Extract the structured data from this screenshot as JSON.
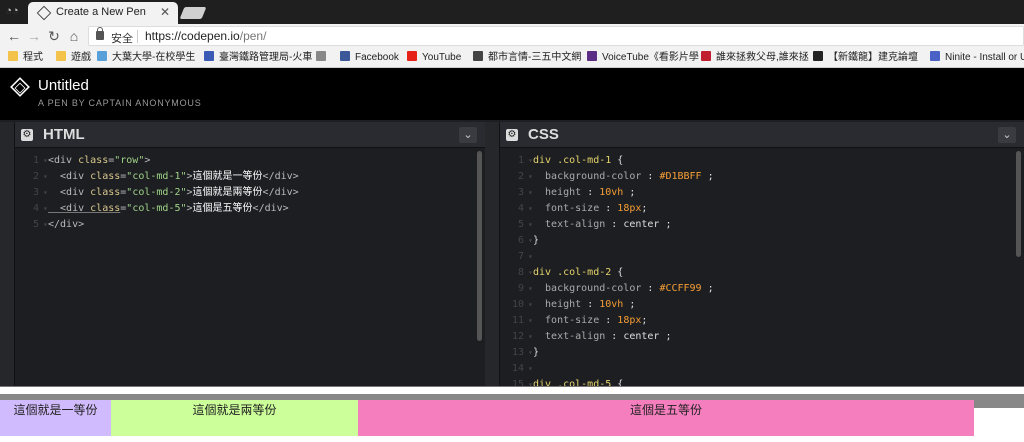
{
  "browser": {
    "tab_title": "Create a New Pen",
    "secure_label": "安全",
    "url_host": "https://codepen.io",
    "url_path": "/pen/",
    "bookmarks": [
      {
        "label": "程式",
        "color": "#f3c24b"
      },
      {
        "label": "遊戲",
        "color": "#f3c24b"
      },
      {
        "label": "大葉大學-在校學生",
        "color": "#5aa0d8"
      },
      {
        "label": "臺灣鐵路管理局-火車",
        "color": "#3b5bb5"
      },
      {
        "label": "",
        "color": "#888888"
      },
      {
        "label": "Facebook",
        "color": "#3b5998"
      },
      {
        "label": "YouTube",
        "color": "#e62117"
      },
      {
        "label": "都市言情-三五中文網",
        "color": "#444444"
      },
      {
        "label": "VoiceTube《看影片學",
        "color": "#5b2c83"
      },
      {
        "label": "誰來拯救父母,誰來拯",
        "color": "#c02030"
      },
      {
        "label": "【新鐵龍】建克論壇",
        "color": "#222222"
      },
      {
        "label": "Ninite - Install or Up",
        "color": "#4a62c6"
      }
    ]
  },
  "pen": {
    "title": "Untitled",
    "subtitle": "A PEN BY CAPTAIN ANONYMOUS"
  },
  "html_panel": {
    "label": "HTML",
    "lines": [
      {
        "n": "1",
        "tokens": [
          {
            "c": "t-tag",
            "t": "<div "
          },
          {
            "c": "t-attr",
            "t": "class"
          },
          {
            "c": "t-tag",
            "t": "="
          },
          {
            "c": "t-str",
            "t": "\"row\""
          },
          {
            "c": "t-tag",
            "t": ">"
          }
        ]
      },
      {
        "n": "2",
        "tokens": [
          {
            "c": "t-tag",
            "t": "  <div "
          },
          {
            "c": "t-attr",
            "t": "class"
          },
          {
            "c": "t-tag",
            "t": "="
          },
          {
            "c": "t-str",
            "t": "\"col-md-1\""
          },
          {
            "c": "t-tag",
            "t": ">"
          },
          {
            "c": "t-cjk",
            "t": "這個就是一等份"
          },
          {
            "c": "t-tag",
            "t": "</div>"
          }
        ]
      },
      {
        "n": "3",
        "tokens": [
          {
            "c": "t-tag",
            "t": "  <div "
          },
          {
            "c": "t-attr",
            "t": "class"
          },
          {
            "c": "t-tag",
            "t": "="
          },
          {
            "c": "t-str",
            "t": "\"col-md-2\""
          },
          {
            "c": "t-tag",
            "t": ">"
          },
          {
            "c": "t-cjk",
            "t": "這個就是兩等份"
          },
          {
            "c": "t-tag",
            "t": "</div>"
          }
        ]
      },
      {
        "n": "4",
        "tokens": [
          {
            "c": "t-tag u",
            "t": "  <div "
          },
          {
            "c": "t-attr u",
            "t": "class"
          },
          {
            "c": "t-tag",
            "t": "="
          },
          {
            "c": "t-str",
            "t": "\"col-md-5\""
          },
          {
            "c": "t-tag",
            "t": ">"
          },
          {
            "c": "t-cjk",
            "t": "這個是五等份"
          },
          {
            "c": "t-tag",
            "t": "</div>"
          }
        ]
      },
      {
        "n": "5",
        "tokens": [
          {
            "c": "t-tag",
            "t": "</div>"
          }
        ]
      }
    ]
  },
  "css_panel": {
    "label": "CSS",
    "lines": [
      {
        "n": "1",
        "tokens": [
          {
            "c": "t-sel",
            "t": "div .col-md-1 "
          },
          {
            "c": "t-punc",
            "t": "{"
          }
        ]
      },
      {
        "n": "2",
        "tokens": [
          {
            "c": "t-prop",
            "t": "  background-color "
          },
          {
            "c": "t-punc",
            "t": ": "
          },
          {
            "c": "t-val",
            "t": "#D1BBFF"
          },
          {
            "c": "t-punc",
            "t": " ;"
          }
        ]
      },
      {
        "n": "3",
        "tokens": [
          {
            "c": "t-prop",
            "t": "  height "
          },
          {
            "c": "t-punc",
            "t": ": "
          },
          {
            "c": "t-val",
            "t": "10vh"
          },
          {
            "c": "t-punc",
            "t": " ;"
          }
        ]
      },
      {
        "n": "4",
        "tokens": [
          {
            "c": "t-prop",
            "t": "  font-size "
          },
          {
            "c": "t-punc",
            "t": ": "
          },
          {
            "c": "t-val",
            "t": "18px"
          },
          {
            "c": "t-punc",
            "t": ";"
          }
        ]
      },
      {
        "n": "5",
        "tokens": [
          {
            "c": "t-prop",
            "t": "  text-align "
          },
          {
            "c": "t-punc",
            "t": ": center ;"
          }
        ]
      },
      {
        "n": "6",
        "tokens": [
          {
            "c": "t-punc",
            "t": "}"
          }
        ]
      },
      {
        "n": "7",
        "tokens": []
      },
      {
        "n": "8",
        "tokens": [
          {
            "c": "t-sel",
            "t": "div .col-md-2 "
          },
          {
            "c": "t-punc",
            "t": "{"
          }
        ]
      },
      {
        "n": "9",
        "tokens": [
          {
            "c": "t-prop",
            "t": "  background-color "
          },
          {
            "c": "t-punc",
            "t": ": "
          },
          {
            "c": "t-val",
            "t": "#CCFF99"
          },
          {
            "c": "t-punc",
            "t": " ;"
          }
        ]
      },
      {
        "n": "10",
        "tokens": [
          {
            "c": "t-prop",
            "t": "  height "
          },
          {
            "c": "t-punc",
            "t": ": "
          },
          {
            "c": "t-val",
            "t": "10vh"
          },
          {
            "c": "t-punc",
            "t": " ;"
          }
        ]
      },
      {
        "n": "11",
        "tokens": [
          {
            "c": "t-prop",
            "t": "  font-size "
          },
          {
            "c": "t-punc",
            "t": ": "
          },
          {
            "c": "t-val",
            "t": "18px"
          },
          {
            "c": "t-punc",
            "t": ";"
          }
        ]
      },
      {
        "n": "12",
        "tokens": [
          {
            "c": "t-prop",
            "t": "  text-align "
          },
          {
            "c": "t-punc",
            "t": ": center ;"
          }
        ]
      },
      {
        "n": "13",
        "tokens": [
          {
            "c": "t-punc",
            "t": "}"
          }
        ]
      },
      {
        "n": "14",
        "tokens": []
      },
      {
        "n": "15",
        "tokens": [
          {
            "c": "t-sel",
            "t": "div .col-md-5 "
          },
          {
            "c": "t-punc",
            "t": "{"
          }
        ]
      }
    ]
  },
  "result": {
    "columns": [
      {
        "label": "這個就是一等份",
        "color": "#D1BBFF"
      },
      {
        "label": "這個就是兩等份",
        "color": "#CCFF99"
      },
      {
        "label": "這個是五等份",
        "color": "#F57EBF"
      }
    ]
  }
}
